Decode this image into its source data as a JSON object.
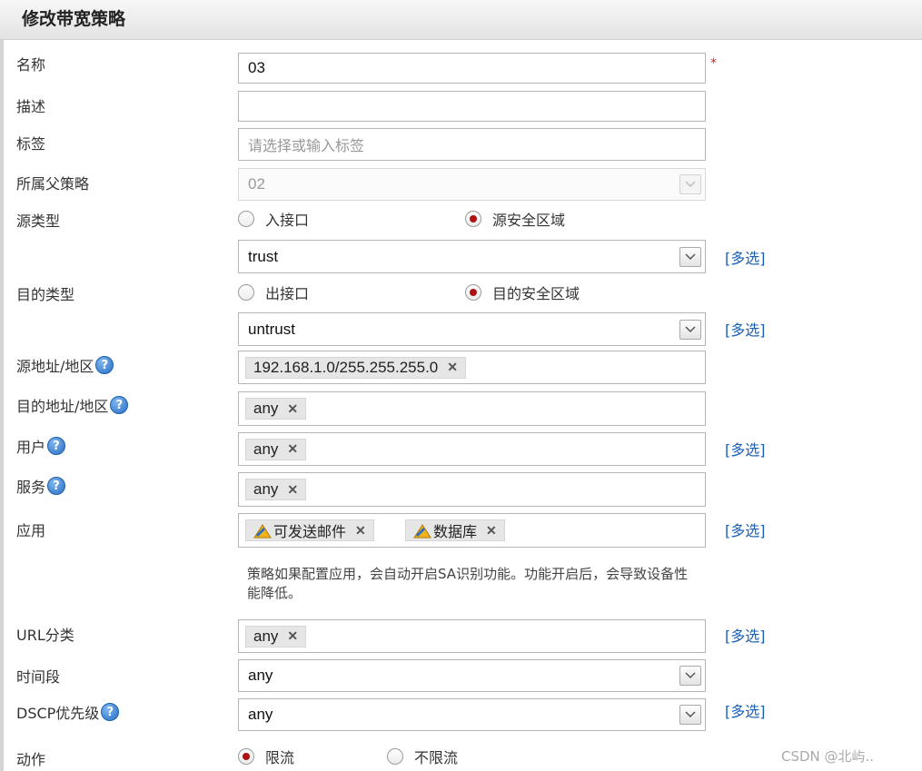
{
  "dialog": {
    "title": "修改带宽策略"
  },
  "icons": {
    "help": "?",
    "remove": "✕",
    "dropdown": "chevron-down-icon",
    "app": "app-icon"
  },
  "colors": {
    "link": "#1a5fb4",
    "required": "#e02020",
    "radio_checked": "#b01010"
  },
  "form": {
    "name": {
      "label": "名称",
      "value": "03",
      "required_mark": "*"
    },
    "description": {
      "label": "描述",
      "value": ""
    },
    "tags": {
      "label": "标签",
      "placeholder": "请选择或输入标签"
    },
    "parent_policy": {
      "label": "所属父策略",
      "value": "02"
    },
    "source_type": {
      "label": "源类型",
      "options": [
        {
          "label": "入接口",
          "checked": false
        },
        {
          "label": "源安全区域",
          "checked": true
        }
      ],
      "zone_value": "trust",
      "multi_label": "[多选]"
    },
    "dest_type": {
      "label": "目的类型",
      "options": [
        {
          "label": "出接口",
          "checked": false
        },
        {
          "label": "目的安全区域",
          "checked": true
        }
      ],
      "zone_value": "untrust",
      "multi_label": "[多选]"
    },
    "source_address": {
      "label": "源地址/地区",
      "tags": [
        "192.168.1.0/255.255.255.0"
      ]
    },
    "dest_address": {
      "label": "目的地址/地区",
      "tags": [
        "any"
      ]
    },
    "user": {
      "label": "用户",
      "tags": [
        "any"
      ],
      "multi_label": "[多选]"
    },
    "service": {
      "label": "服务",
      "tags": [
        "any"
      ]
    },
    "application": {
      "label": "应用",
      "tags": [
        "可发送邮件",
        "数据库"
      ],
      "multi_label": "[多选]",
      "note": "策略如果配置应用，会自动开启SA识别功能。功能开启后，会导致设备性能降低。"
    },
    "url_category": {
      "label": "URL分类",
      "tags": [
        "any"
      ],
      "multi_label": "[多选]"
    },
    "time_range": {
      "label": "时间段",
      "value": "any"
    },
    "dscp_priority": {
      "label": "DSCP优先级",
      "value": "any",
      "multi_label": "[多选]"
    },
    "action": {
      "label": "动作",
      "options": [
        {
          "label": "限流",
          "checked": true
        },
        {
          "label": "不限流",
          "checked": false
        }
      ]
    }
  },
  "watermark": "CSDN @北屿.."
}
